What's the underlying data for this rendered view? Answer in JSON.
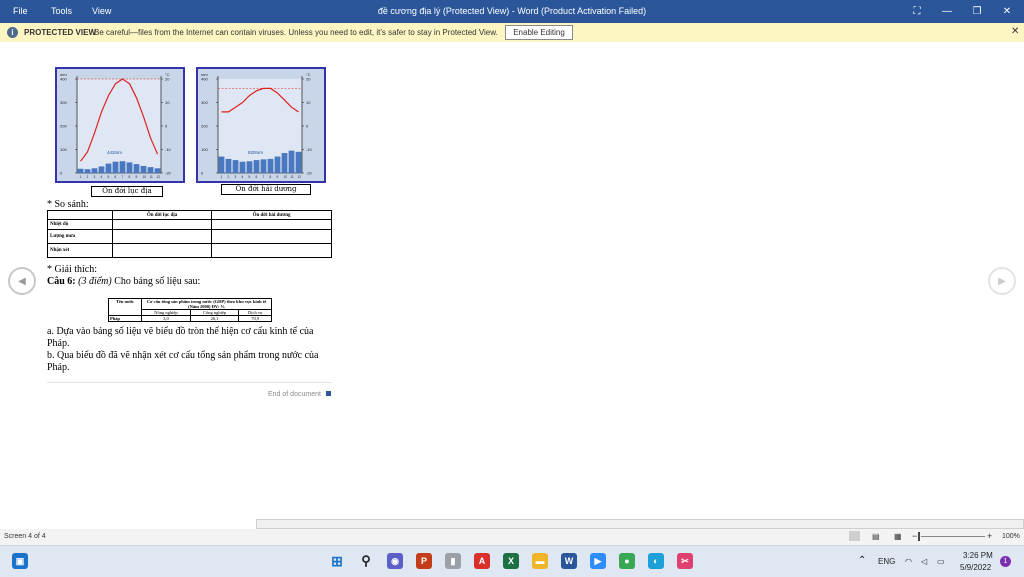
{
  "titlebar": {
    "menu": [
      "File",
      "Tools",
      "View"
    ],
    "title": "đề cương địa lý (Protected View) - Word (Product Activation Failed)"
  },
  "protected_bar": {
    "label": "PROTECTED VIEW",
    "message": "Be careful—files from the Internet can contain viruses. Unless you need to edit, it's safer to stay in Protected View.",
    "button": "Enable Editing"
  },
  "document": {
    "chart_left": {
      "unit_left": "mm",
      "unit_right": "°C",
      "yticks_left": [
        "400",
        "300",
        "200",
        "100",
        "0"
      ],
      "yticks_right": [
        "20",
        "10",
        "0",
        "-10",
        "-20"
      ],
      "annotation": "443mm",
      "caption": "Ôn đới lục địa",
      "temperature_c": [
        -15,
        -11,
        -3,
        6,
        13,
        18,
        20,
        18,
        12,
        4,
        -5,
        -12
      ],
      "precip_mm": [
        18,
        16,
        20,
        28,
        40,
        48,
        50,
        45,
        38,
        30,
        25,
        20
      ]
    },
    "chart_right": {
      "unit_left": "mm",
      "unit_right": "°C",
      "yticks_left": [
        "400",
        "300",
        "200",
        "100",
        "0"
      ],
      "yticks_right": [
        "20",
        "10",
        "0",
        "-10",
        "-20"
      ],
      "annotation": "820mm",
      "caption": "Ôn đới hải dương",
      "temperature_c": [
        6,
        6,
        8,
        10,
        13,
        15,
        16,
        16,
        14,
        11,
        8,
        6
      ],
      "precip_mm": [
        70,
        60,
        55,
        48,
        50,
        55,
        58,
        60,
        70,
        85,
        95,
        90
      ]
    },
    "so_sanh": "* So sánh:",
    "compare_table": {
      "headers": [
        "",
        "Ôn đới lục địa",
        "Ôn đới hải dương"
      ],
      "rows": [
        "Nhiệt độ",
        "Lượng mưa",
        "Nhận xét"
      ]
    },
    "giai_thich": "* Giải thích:",
    "cau6_label": "Câu 6:",
    "cau6_points": "(3 điểm)",
    "cau6_text": "Cho bảng số liệu sau:",
    "gdp_table": {
      "h_country": "Tên nước",
      "h_main": "Cơ cấu tổng sản phẩm trong nước (GDP) theo khu vực kinh tế (Năm 2000) ĐV: %",
      "h_sub": [
        "Nông nghiệp",
        "Công nghiệp",
        "Dịch vụ"
      ],
      "country": "Pháp",
      "values": [
        "3,0",
        "26,1",
        "70,9"
      ]
    },
    "q_a_1": "a. Dựa vào bảng số liệu vẽ biểu đồ tròn thể hiện cơ cấu kinh tế của",
    "q_a_2": "Pháp.",
    "q_b_1": "b. Qua biểu đồ đã vẽ nhận xét cơ cấu tổng sản phẩm trong nước của",
    "q_b_2": "Pháp.",
    "end": "End of document"
  },
  "status": {
    "screen": "Screen 4 of 4",
    "zoom": "100%"
  },
  "taskbar": {
    "lang": "ENG",
    "time": "3:26 PM",
    "date": "5/9/2022",
    "badge": "1"
  },
  "colors": {
    "title_bg": "#2b579a",
    "protected_bg": "#fdf6c3",
    "chart_border": "#3333aa",
    "temp_line": "#e02020",
    "precip_bar": "#4a78c0"
  }
}
